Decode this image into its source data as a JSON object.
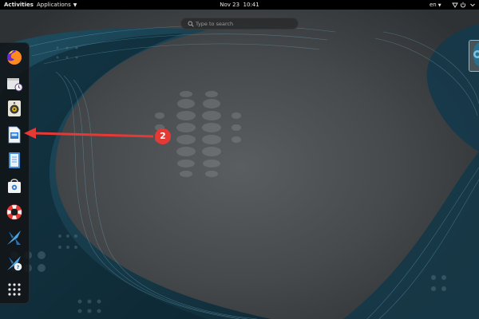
{
  "topbar": {
    "activities": "Activities",
    "applications": "Applications",
    "clock": "Nov 23  10:41",
    "language": "en",
    "tray_icons": [
      "network-icon",
      "volume-icon",
      "power-icon",
      "system-menu-chevron-icon"
    ]
  },
  "search": {
    "placeholder": "Type to search",
    "value": ""
  },
  "dash": {
    "items": [
      {
        "name": "firefox",
        "icon": "firefox-icon"
      },
      {
        "name": "software-install",
        "icon": "package-clock-icon"
      },
      {
        "name": "rhythmbox",
        "icon": "speaker-icon"
      },
      {
        "name": "libreoffice-impress",
        "icon": "presentation-icon",
        "highlighted": true
      },
      {
        "name": "document-viewer",
        "icon": "document-icon"
      },
      {
        "name": "software",
        "icon": "shopping-bag-icon"
      },
      {
        "name": "help",
        "icon": "lifebuoy-icon"
      },
      {
        "name": "app-x",
        "icon": "x-logo-icon"
      },
      {
        "name": "app-x-help",
        "icon": "x-logo-help-icon"
      },
      {
        "name": "show-applications",
        "icon": "grid-icon"
      }
    ]
  },
  "annotation": {
    "step_number": "2",
    "color": "#e53935"
  },
  "colors": {
    "topbar": "#000000",
    "accent_blue": "#2a7bd1",
    "annotation_red": "#e53935"
  }
}
